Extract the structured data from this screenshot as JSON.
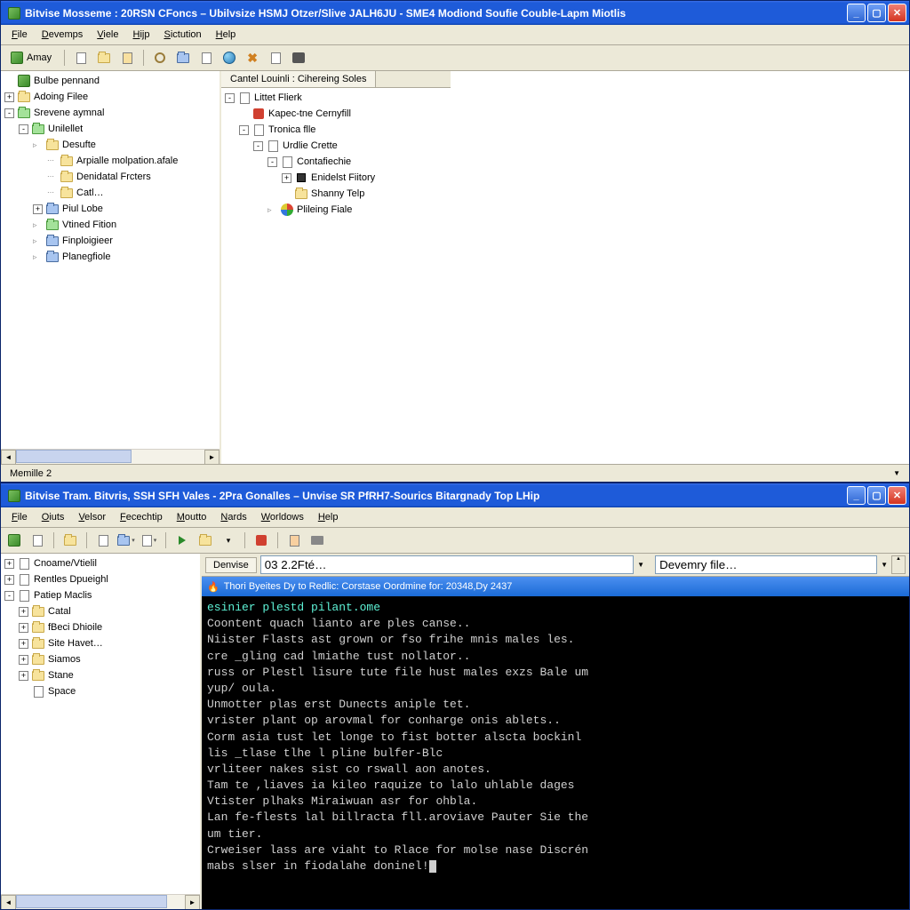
{
  "topWindow": {
    "title": "Bitvise Mosseme : 20RSN CFoncs – Ubilvsize HSMJ Otzer/Slive JALH6JU - SME4 Modiond Soufie Couble-Lapm Miotlis",
    "menus": [
      "File",
      "Devemps",
      "Viele",
      "Hijp",
      "Sictution",
      "Help"
    ],
    "toolbarTextBtn": "Amay",
    "leftTree": [
      {
        "level": 0,
        "exp": "",
        "icon": "app",
        "label": "Bulbe pennand"
      },
      {
        "level": 0,
        "exp": "+",
        "icon": "folder",
        "label": "Adoing Filee"
      },
      {
        "level": 0,
        "exp": "-",
        "icon": "folder-green",
        "label": "Srevene aymnal"
      },
      {
        "level": 1,
        "exp": "-",
        "icon": "folder-green",
        "label": "Unilellet"
      },
      {
        "level": 2,
        "exp": "tri",
        "icon": "folder",
        "label": "Desufte"
      },
      {
        "level": 3,
        "exp": "dot",
        "icon": "folder",
        "label": "Arpialle molpation.afale"
      },
      {
        "level": 3,
        "exp": "dot",
        "icon": "folder",
        "label": "Denidatal Frcters"
      },
      {
        "level": 3,
        "exp": "dot",
        "icon": "folder",
        "label": "Catl…"
      },
      {
        "level": 2,
        "exp": "+",
        "icon": "folder-blue",
        "label": "Piul Lobe"
      },
      {
        "level": 2,
        "exp": "tri",
        "icon": "folder-green",
        "label": "Vtined Fition"
      },
      {
        "level": 2,
        "exp": "tri",
        "icon": "folder-blue",
        "label": "Finploigieer"
      },
      {
        "level": 2,
        "exp": "tri",
        "icon": "folder-blue",
        "label": "Planegfiole"
      }
    ],
    "rightTab": "Cantel Louinli : Cihereing Soles",
    "rightTree": [
      {
        "level": 0,
        "exp": "-",
        "icon": "file",
        "label": "Littet Flierk"
      },
      {
        "level": 1,
        "exp": "",
        "icon": "red",
        "label": "Kapec-tne Cernyfill"
      },
      {
        "level": 1,
        "exp": "-",
        "icon": "file",
        "label": "Tronica flle"
      },
      {
        "level": 2,
        "exp": "-",
        "icon": "file",
        "label": "Urdlie Crette"
      },
      {
        "level": 3,
        "exp": "-",
        "icon": "file",
        "label": "Contafiechie"
      },
      {
        "level": 4,
        "exp": "+",
        "icon": "stop",
        "label": "Enidelst Fiitory"
      },
      {
        "level": 4,
        "exp": "",
        "icon": "folder",
        "label": "Shanny Telp"
      },
      {
        "level": 3,
        "exp": "tri",
        "icon": "multi",
        "label": "Plileing Fiale"
      }
    ],
    "statusLeft": "Memille 2"
  },
  "bottomWindow": {
    "title": "Bitvise Tram. Bitvris, SSH SFH Vales - 2Pra Gonalles – Unvise SR PfRH7-Sourics Bitargnady Top LHip",
    "menus": [
      "File",
      "Oiuts",
      "Velsor",
      "Fecechtip",
      "Moutto",
      "Nards",
      "Worldows",
      "Help"
    ],
    "breadcrumb": {
      "btn": "Denvise",
      "path": "03 2.2Fté…",
      "right": "Devemry file…"
    },
    "leftTree": [
      {
        "level": 0,
        "exp": "+",
        "icon": "file",
        "label": "Cnoame/Vtielil"
      },
      {
        "level": 0,
        "exp": "+",
        "icon": "file",
        "label": "Rentles Dpueighl"
      },
      {
        "level": 0,
        "exp": "-",
        "icon": "file",
        "label": "Patiep Maclis"
      },
      {
        "level": 1,
        "exp": "+",
        "icon": "folder",
        "label": "Catal"
      },
      {
        "level": 1,
        "exp": "+",
        "icon": "folder",
        "label": "fBeci Dhioile"
      },
      {
        "level": 1,
        "exp": "+",
        "icon": "folder",
        "label": "Site Havet…"
      },
      {
        "level": 1,
        "exp": "+",
        "icon": "folder",
        "label": "Siamos"
      },
      {
        "level": 1,
        "exp": "+",
        "icon": "folder",
        "label": "Stane"
      },
      {
        "level": 1,
        "exp": "",
        "icon": "file",
        "label": "Space"
      }
    ],
    "terminalTitle": "Thori Byeites Dy to Redlic: Corstase Oordmine for: 20348,Dy 2437",
    "terminalLines": [
      {
        "cls": "cyan",
        "text": "esinier plestd pilant.ome"
      },
      {
        "cls": "",
        "text": ""
      },
      {
        "cls": "",
        "text": "Coontent quach lianto are ples canse.."
      },
      {
        "cls": "",
        "text": "Niister Flasts ast grown or fso frihe mnis males les."
      },
      {
        "cls": "",
        "text": "cre _gling cad lmiathe tust nollator.."
      },
      {
        "cls": "",
        "text": "russ or Plestl lisure tute file hust males exzs Bale um"
      },
      {
        "cls": "",
        "text": "yup/ oula."
      },
      {
        "cls": "",
        "text": "Unmotter plas erst Dunects aniple tet."
      },
      {
        "cls": "",
        "text": "vrister plant op arovmal for conharge onis ablets.."
      },
      {
        "cls": "",
        "text": "Corm asia tust let longe to fist botter alscta bockinl"
      },
      {
        "cls": "",
        "text": "lis _tlase tlhe l pline bulfer-Blc"
      },
      {
        "cls": "",
        "text": "vrliteer nakes sist co rswall aon anotes."
      },
      {
        "cls": "",
        "text": "Tam te ,liaves ia kileo raquize to lalo uhlable dages"
      },
      {
        "cls": "",
        "text": "Vtister plhaks Miraiwuan asr for ohbla."
      },
      {
        "cls": "",
        "text": "Lan fe-flests lal billracta fll.aroviave Pauter Sie the"
      },
      {
        "cls": "",
        "text": "um tier."
      },
      {
        "cls": "",
        "text": "Crweiser lass are viaht to Rlace for molse nase Discrén"
      },
      {
        "cls": "",
        "text": "mabs slser in fiodalahe doninel!",
        "cursor": true
      }
    ]
  }
}
